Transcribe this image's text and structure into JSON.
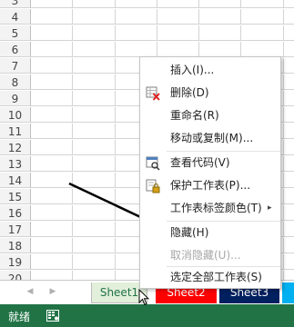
{
  "rows": [
    "3",
    "4",
    "5",
    "6",
    "7",
    "8",
    "9",
    "10",
    "11",
    "12",
    "13",
    "14",
    "15",
    "16",
    "17",
    "18",
    "19",
    "20"
  ],
  "menu": {
    "items": [
      {
        "label": "插入(I)...",
        "icon": "none"
      },
      {
        "label": "删除(D)",
        "icon": "delete-sheet-icon"
      },
      {
        "label": "重命名(R)",
        "icon": "none"
      },
      {
        "label": "移动或复制(M)...",
        "icon": "none"
      },
      {
        "label": "查看代码(V)",
        "icon": "view-code-icon"
      },
      {
        "label": "保护工作表(P)...",
        "icon": "protect-sheet-icon"
      },
      {
        "label": "工作表标签颜色(T)",
        "icon": "none",
        "submenu": "▸"
      },
      {
        "label": "隐藏(H)",
        "icon": "none"
      },
      {
        "label": "取消隐藏(U)...",
        "icon": "none",
        "disabled": true
      },
      {
        "label": "选定全部工作表(S)",
        "icon": "none"
      }
    ]
  },
  "tabs": {
    "nav_prev": "◀",
    "nav_next": "▶",
    "sheet1": "Sheet1",
    "sheet2": "Sheet2",
    "sheet3": "Sheet3",
    "sheet1_color": "#e2efda",
    "sheet2_color": "#ff0000",
    "sheet3_color": "#002060",
    "sheet4_color": "#00b0f0"
  },
  "status": {
    "ready": "就绪",
    "accent": "#217346"
  }
}
